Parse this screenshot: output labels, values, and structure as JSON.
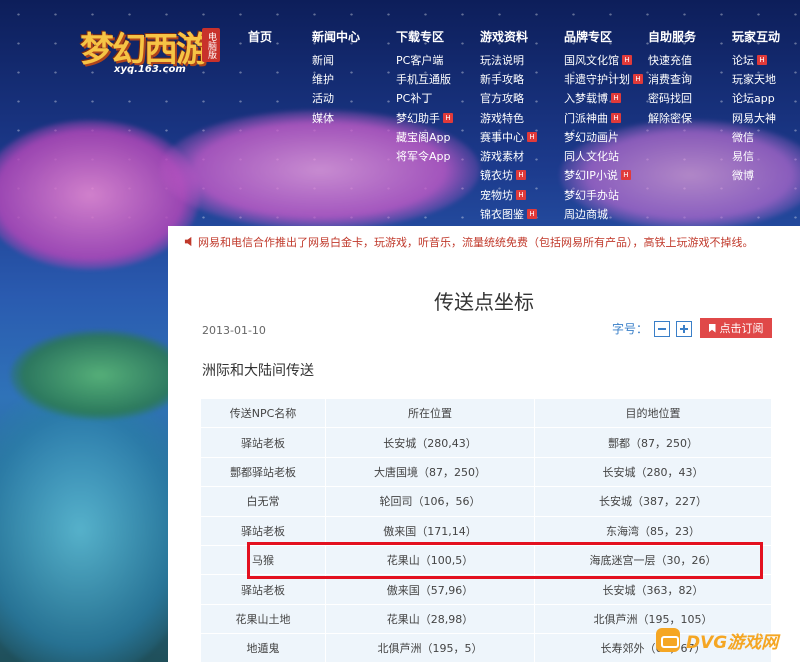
{
  "logo": {
    "title": "梦幻西游",
    "badge": "电脑版",
    "url": "xyq.163.com"
  },
  "nav": [
    {
      "head": "首页",
      "items": []
    },
    {
      "head": "新闻中心",
      "items": [
        {
          "label": "新闻"
        },
        {
          "label": "维护"
        },
        {
          "label": "活动"
        },
        {
          "label": "媒体"
        }
      ]
    },
    {
      "head": "下载专区",
      "items": [
        {
          "label": "PC客户端"
        },
        {
          "label": "手机互通版"
        },
        {
          "label": "PC补丁"
        },
        {
          "label": "梦幻助手",
          "hot": true
        },
        {
          "label": "藏宝阁App"
        },
        {
          "label": "将军令App"
        }
      ]
    },
    {
      "head": "游戏资料",
      "items": [
        {
          "label": "玩法说明"
        },
        {
          "label": "新手攻略"
        },
        {
          "label": "官方攻略"
        },
        {
          "label": "游戏特色"
        },
        {
          "label": "赛事中心",
          "hot": true
        },
        {
          "label": "游戏素材"
        },
        {
          "label": "镜衣坊",
          "hot": true
        },
        {
          "label": "宠物坊",
          "hot": true
        },
        {
          "label": "锦衣图鉴",
          "hot": true
        }
      ]
    },
    {
      "head": "品牌专区",
      "items": [
        {
          "label": "国风文化馆",
          "hot": true
        },
        {
          "label": "非遗守护计划",
          "hot": true
        },
        {
          "label": "入梦载博",
          "hot": true
        },
        {
          "label": "门派神曲",
          "hot": true
        },
        {
          "label": "梦幻动画片"
        },
        {
          "label": "同人文化站"
        },
        {
          "label": "梦幻IP小说",
          "hot": true
        },
        {
          "label": "梦幻手办站"
        },
        {
          "label": "周边商城"
        }
      ]
    },
    {
      "head": "自助服务",
      "items": [
        {
          "label": "快速充值"
        },
        {
          "label": "消费查询"
        },
        {
          "label": "密码找回"
        },
        {
          "label": "解除密保"
        }
      ]
    },
    {
      "head": "玩家互动",
      "items": [
        {
          "label": "论坛",
          "hot": true
        },
        {
          "label": "玩家天地"
        },
        {
          "label": "论坛app"
        },
        {
          "label": "网易大神"
        },
        {
          "label": "微信"
        },
        {
          "label": "易信"
        },
        {
          "label": "微博"
        }
      ]
    }
  ],
  "notice": "网易和电信合作推出了网易白金卡，玩游戏，听音乐，流量统统免费（包括网易所有产品），高铁上玩游戏不掉线。",
  "article": {
    "title": "传送点坐标",
    "date": "2013-01-10",
    "font_size_label": "字号：",
    "subscribe_label": "点击订阅",
    "section_title": "洲际和大陆间传送"
  },
  "table": {
    "headers": [
      "传送NPC名称",
      "所在位置",
      "目的地位置"
    ],
    "rows": [
      [
        "驿站老板",
        "长安城（280,43）",
        "酆都（87，250）"
      ],
      [
        "酆都驿站老板",
        "大唐国境（87，250）",
        "长安城（280，43）"
      ],
      [
        "白无常",
        "轮回司（106，56）",
        "长安城（387，227）"
      ],
      [
        "驿站老板",
        "傲来国（171,14）",
        "东海湾（85，23）"
      ],
      [
        "马猴",
        "花果山（100,5）",
        "海底迷宫一层（30，26）"
      ],
      [
        "驿站老板",
        "傲来国（57,96）",
        "长安城（363，82）"
      ],
      [
        "花果山土地",
        "花果山（28,98）",
        "北俱芦洲（195，105）"
      ],
      [
        "地遁鬼",
        "北俱芦洲（195，5）",
        "长寿郊外（60，67）"
      ]
    ]
  },
  "watermark": "DVG游戏网"
}
